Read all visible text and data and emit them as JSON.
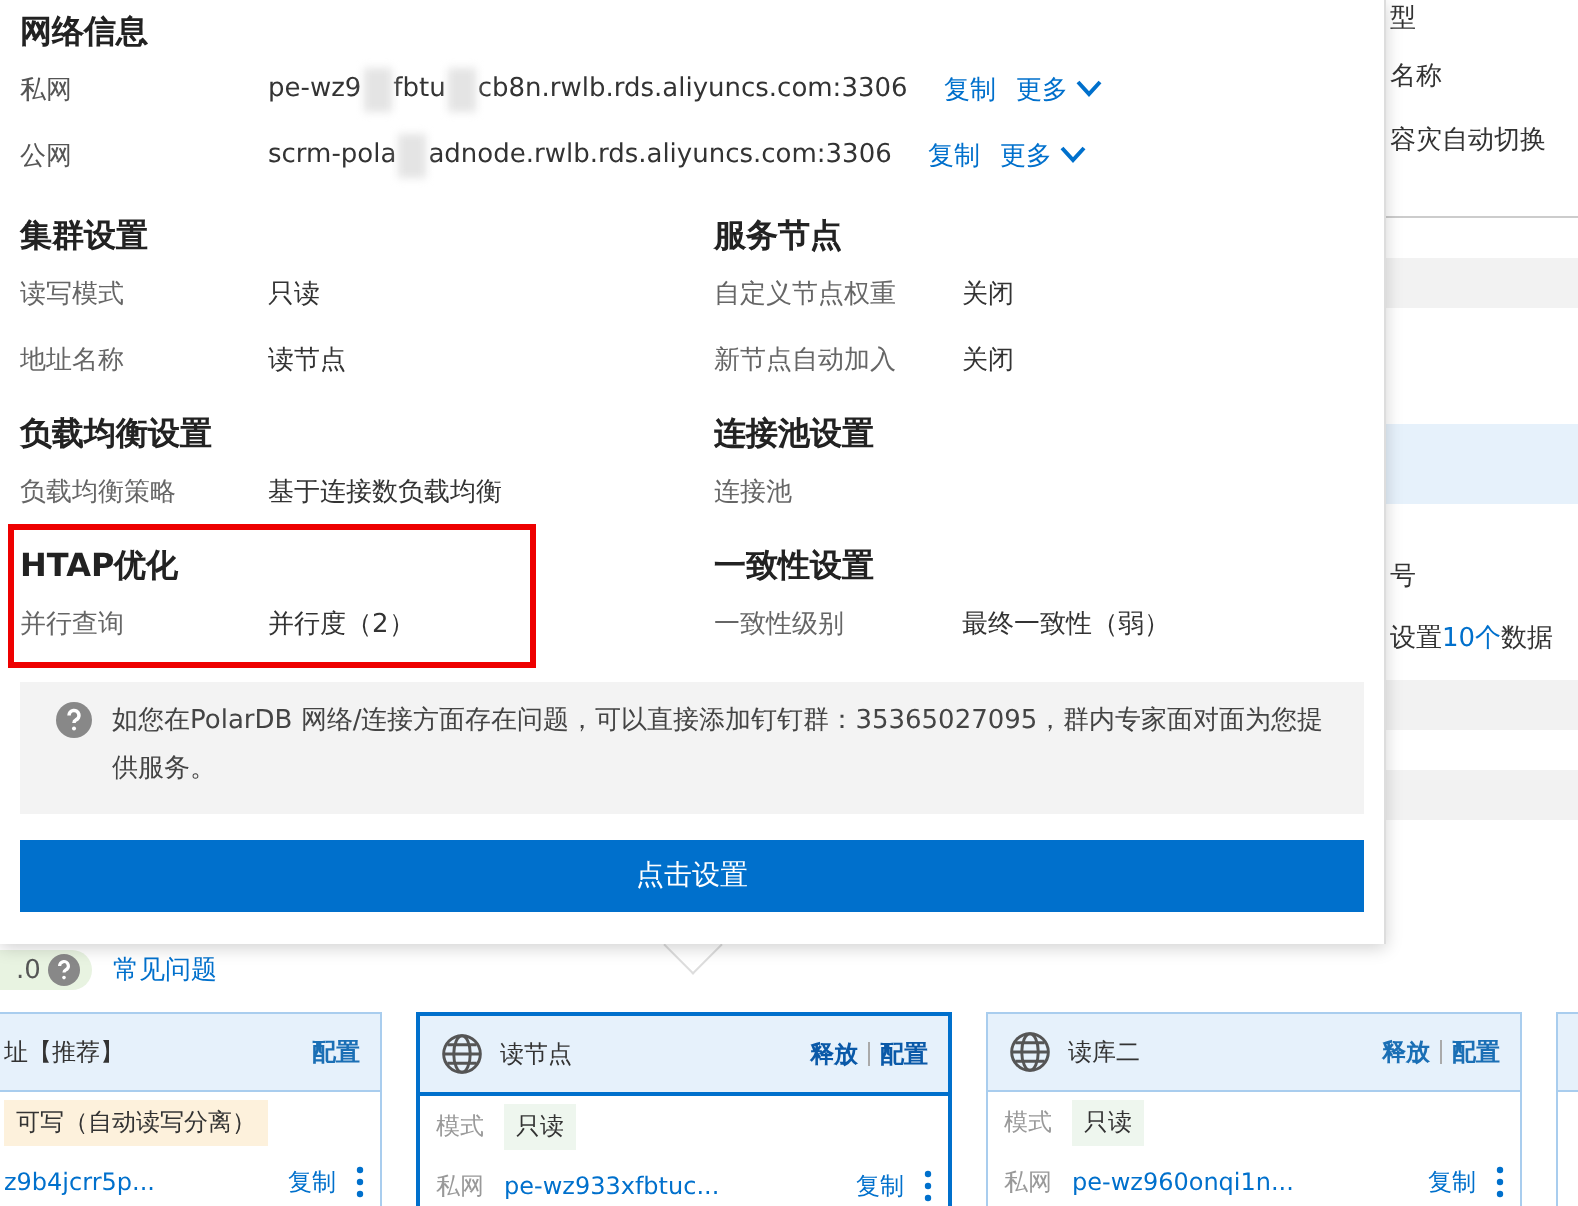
{
  "network": {
    "title": "网络信息",
    "rows": [
      {
        "label": "私网",
        "address_parts": [
          "pe-wz9",
          "fbtu",
          "cb8n.rwlb.rds.aliyuncs.com:3306"
        ],
        "copy": "复制",
        "more": "更多"
      },
      {
        "label": "公网",
        "address_parts": [
          "scrm-pola",
          "adnode.rwlb.rds.aliyuncs.com:3306"
        ],
        "copy": "复制",
        "more": "更多"
      }
    ]
  },
  "sections": [
    {
      "title": "集群设置",
      "highlighted": false,
      "rows": [
        {
          "label": "读写模式",
          "value": "只读"
        },
        {
          "label": "地址名称",
          "value": "读节点"
        }
      ]
    },
    {
      "title": "服务节点",
      "highlighted": false,
      "rows": [
        {
          "label": "自定义节点权重",
          "value": "关闭"
        },
        {
          "label": "新节点自动加入",
          "value": "关闭"
        }
      ]
    },
    {
      "title": "负载均衡设置",
      "highlighted": false,
      "rows": [
        {
          "label": "负载均衡策略",
          "value": "基于连接数负载均衡"
        }
      ]
    },
    {
      "title": "连接池设置",
      "highlighted": false,
      "rows": [
        {
          "label": "连接池"
        }
      ]
    },
    {
      "title": "HTAP优化",
      "highlighted": true,
      "rows": [
        {
          "label": "并行查询",
          "value": "并行度（2）"
        }
      ]
    },
    {
      "title": "一致性设置",
      "highlighted": false,
      "rows": [
        {
          "label": "一致性级别",
          "value": "最终一致性（弱）"
        }
      ]
    }
  ],
  "notice": "如您在PolarDB 网络/连接方面存在问题，可以直接添加钉钉群：35365027095，群内专家面对面为您提供服务。",
  "action_button": "点击设置",
  "background": {
    "side_labels": [
      "型",
      "名称",
      "容灾自动切换"
    ],
    "side_label_2": "号",
    "side_notice": {
      "before": "设置",
      "link": "10个",
      "after": "数据"
    },
    "version_badge": ".0",
    "faq_link": "常见问题",
    "cards": [
      {
        "title": "址【推荐】",
        "selected": false,
        "icon": false,
        "actions": [
          "配置"
        ],
        "mode": {
          "text": "可写（自动读写分离）",
          "color": "#fdf1dc"
        },
        "address": "z9b4jcrr5p...",
        "copy": "复制"
      },
      {
        "title": "读节点",
        "selected": true,
        "icon": true,
        "actions": [
          "释放",
          "配置"
        ],
        "mode_label": "模式",
        "mode": {
          "text": "只读",
          "color": "#eef6ee"
        },
        "net_label": "私网",
        "address": "pe-wz933xfbtuc...",
        "copy": "复制"
      },
      {
        "title": "读库二",
        "selected": false,
        "icon": true,
        "actions": [
          "释放",
          "配置"
        ],
        "mode_label": "模式",
        "mode": {
          "text": "只读",
          "color": "#eef6ee"
        },
        "net_label": "私网",
        "address": "pe-wz960onqi1n...",
        "copy": "复制"
      }
    ]
  }
}
